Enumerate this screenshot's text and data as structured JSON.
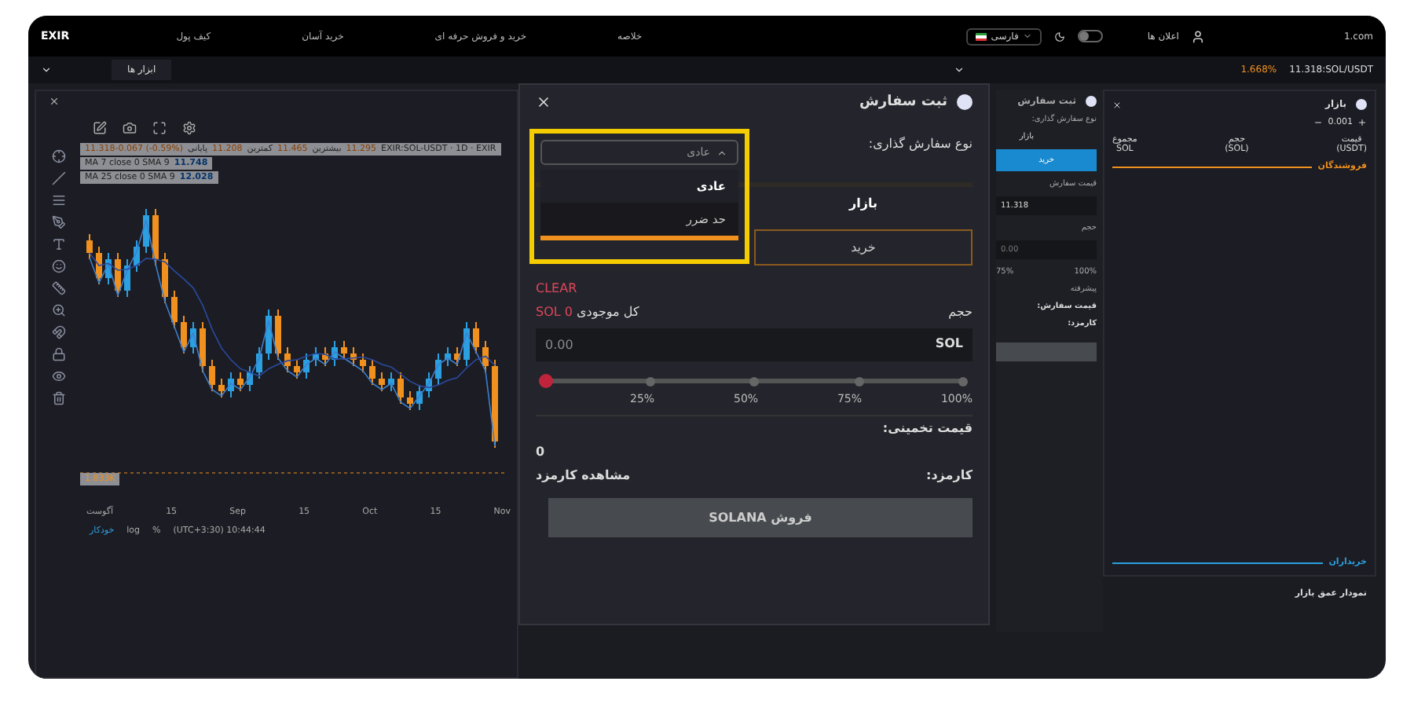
{
  "header": {
    "logo": "EXIR",
    "nav": [
      "خلاصه",
      "خرید و فروش حرفه ای",
      "خرید آسان",
      "کیف پول"
    ],
    "site": "1.com",
    "notifications": "اعلان ها",
    "language": "فارسی",
    "theme_toggle_on": false
  },
  "subbar": {
    "ticker": "11.318:SOL/USDT",
    "change": "1.668%",
    "tools": "ابزار ها"
  },
  "chart": {
    "symbol": "EXIR:SOL-USDT · 1D · EXIR",
    "ohlc": [
      "11.295",
      "بیشترین",
      "11.465",
      "کمترین",
      "11.208",
      "پایانی",
      "11.318-0.067 (-0.59%)"
    ],
    "indicators": [
      {
        "name": "MA 7 close 0 SMA 9",
        "value": "11.748"
      },
      {
        "name": "MA 25 close 0 SMA 9",
        "value": "12.028"
      }
    ],
    "volume": "1.833K",
    "x_labels": [
      "Nov",
      "15",
      "Oct",
      "15",
      "Sep",
      "15",
      "آگوست"
    ],
    "footer": {
      "auto": "خودکار",
      "log": "log",
      "percent": "%",
      "time": "(UTC+3:30) 10:44:44"
    }
  },
  "order_dialog": {
    "title": "ثبت سفارش",
    "order_type_label": "نوع سفارش گذاری:",
    "highlighted": true,
    "order_type": {
      "value": "عادی",
      "expanded": true,
      "options": [
        {
          "label": "عادی",
          "selected": true
        },
        {
          "label": "حد ضرر",
          "selected": false
        }
      ]
    },
    "tab": {
      "label": "بازار",
      "selected": true
    },
    "side": "خرید",
    "clear": "CLEAR",
    "balance_label": "کل موجودی",
    "balance": "SOL 0",
    "volume_label": "حجم",
    "volume_unit": "SOL",
    "volume_placeholder": "0.00",
    "slider": {
      "level": 0,
      "marks": [
        "100%",
        "75%",
        "50%",
        "25%"
      ]
    },
    "estimate_label": "قیمت تخمینی:",
    "estimate": "0",
    "fee_label": "کارمزد:",
    "fee_link": "مشاهده کارمزد",
    "submit": "فروش SOLANA"
  },
  "order_panel": {
    "title": "ثبت سفارش",
    "order_type_label": "نوع سفارش گذاری:",
    "tab": "بازار",
    "side": "خرید",
    "price_label": "قیمت سفارش",
    "price": "11.318",
    "volume_label": "حجم",
    "volume_placeholder": "0.00",
    "marks": [
      "100%",
      "75%"
    ],
    "advanced": "پیشرفته",
    "order_price_label": "قیمت سفارش:",
    "fee_label": "کارمزد:"
  },
  "market": {
    "title": "بازار",
    "step": "0.001",
    "columns": [
      {
        "label": "قیمت",
        "unit": "(USDT)"
      },
      {
        "label": "حجم",
        "unit": "(SOL)"
      },
      {
        "label": "مجموع",
        "unit": "SOL"
      }
    ],
    "sellers": "فروشندگان",
    "buyers": "خریداران"
  },
  "depth_chart": {
    "title": "نمودار عمق بازار"
  }
}
